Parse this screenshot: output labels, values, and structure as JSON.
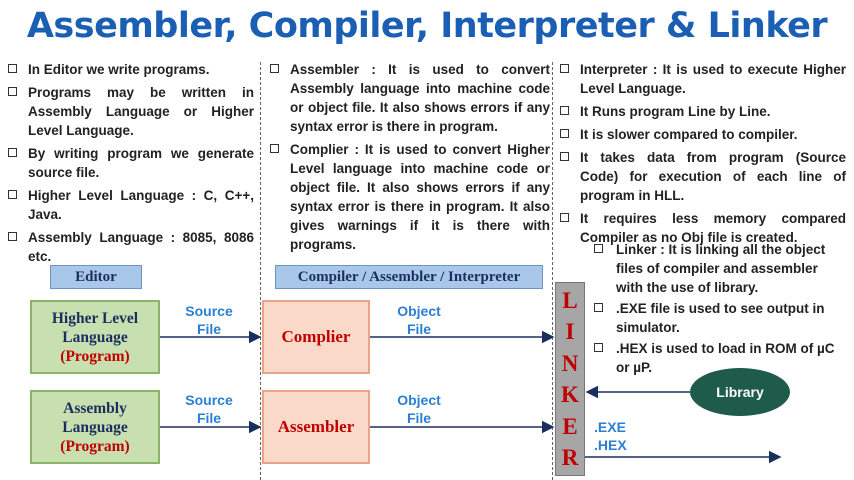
{
  "title": "Assembler, Compiler, Interpreter & Linker",
  "col1": [
    "In Editor we write programs.",
    "Programs may be written in Assembly Language or Higher Level Language.",
    "By writing program we generate source file.",
    "Higher Level Language : C, C++, Java.",
    "Assembly Language : 8085, 8086 etc."
  ],
  "col2": [
    "Assembler : It is used to convert Assembly language into machine code or object file. It also shows errors if any syntax error is there in program.",
    "Complier : It is used to convert Higher Level language into machine code or object file. It also shows errors if any syntax error is there in program. It also gives warnings if it is there with programs."
  ],
  "col3": [
    "Interpreter : It is used to execute Higher Level Language.",
    "It Runs program Line by Line.",
    "It is slower compared to compiler.",
    "It takes data from program (Source Code) for execution of each line of program in HLL.",
    "It requires less memory compared Compiler as no Obj file is created."
  ],
  "col3b": [
    "Linker : It is linking all the object files of compiler and assembler with the use of library.",
    ".EXE file is used to see output in simulator.",
    ".HEX is used to load in ROM of µC or µP."
  ],
  "diagram": {
    "editor_label": "Editor",
    "cai_label": "Compiler / Assembler / Interpreter",
    "hll_line1": "Higher Level",
    "hll_line2": "Language",
    "hll_prog": "(Program)",
    "asm_line1": "Assembly",
    "asm_line2": "Language",
    "asm_prog": "(Program)",
    "compiler": "Complier",
    "assembler": "Assembler",
    "source1a": "Source",
    "source1b": "File",
    "source2a": "Source",
    "source2b": "File",
    "object1a": "Object",
    "object1b": "File",
    "object2a": "Object",
    "object2b": "File",
    "linker_letters": [
      "L",
      "I",
      "N",
      "K",
      "E",
      "R"
    ],
    "library": "Library",
    "exe": ".EXE",
    "hex": ".HEX"
  },
  "colors": {
    "title": "#1a5fb4",
    "accent_red": "#c00000",
    "label_blue": "#2a7fd4",
    "library": "#1e5b4a"
  }
}
